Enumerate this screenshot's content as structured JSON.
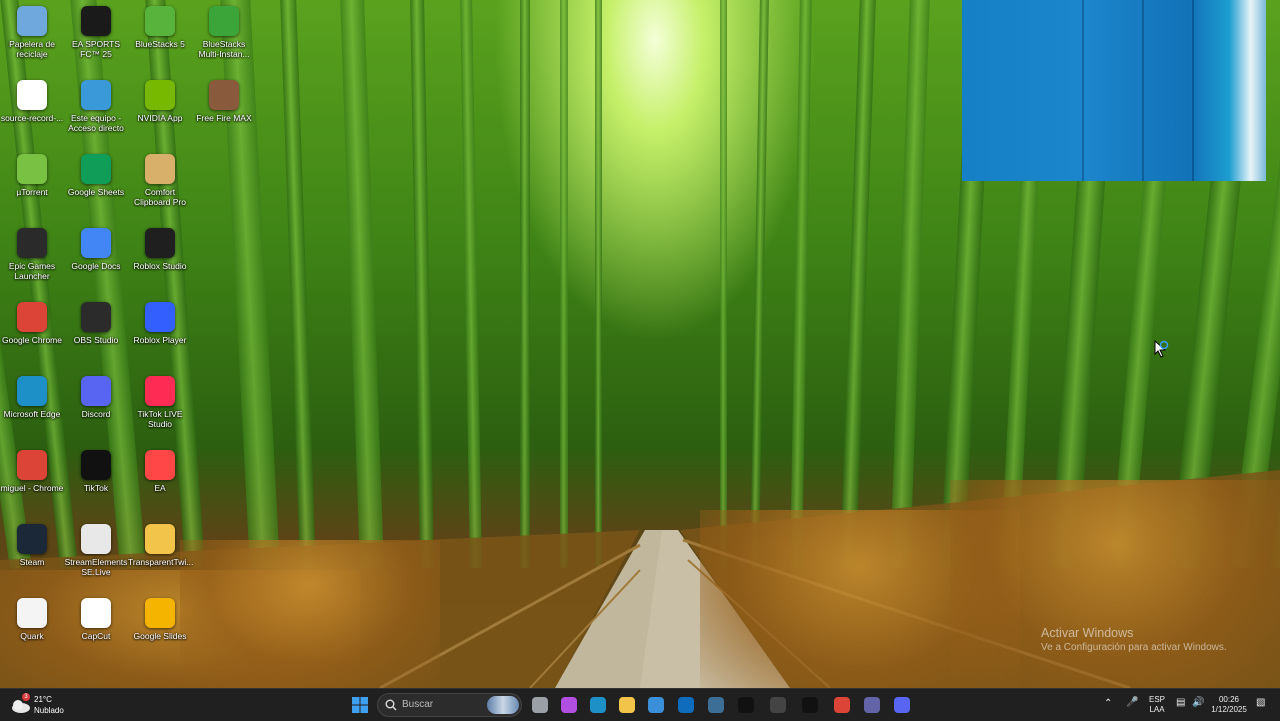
{
  "desktop": {
    "icons": [
      {
        "label": "Papelera de reciclaje",
        "icon": "recycle-bin-icon",
        "color": "#6fa8dc"
      },
      {
        "label": "EA SPORTS FC™ 25",
        "icon": "ea-fc-icon",
        "color": "#1a1a1a"
      },
      {
        "label": "BlueStacks 5",
        "icon": "bluestacks-icon",
        "color": "#58b33c"
      },
      {
        "label": "BlueStacks Multi-Instan...",
        "icon": "bluestacks-multi-icon",
        "color": "#3ba539"
      },
      {
        "label": "source-record-...",
        "icon": "source-record-icon",
        "color": "#ffffff"
      },
      {
        "label": "Este equipo - Acceso directo",
        "icon": "this-pc-icon",
        "color": "#3a9ad9"
      },
      {
        "label": "NVIDIA App",
        "icon": "nvidia-icon",
        "color": "#76b900"
      },
      {
        "label": "Free Fire MAX",
        "icon": "free-fire-icon",
        "color": "#8a5a3c"
      },
      {
        "label": "µTorrent",
        "icon": "utorrent-icon",
        "color": "#79c142"
      },
      {
        "label": "Google Sheets",
        "icon": "google-sheets-icon",
        "color": "#0f9d58"
      },
      {
        "label": "Comfort Clipboard Pro",
        "icon": "clipboard-icon",
        "color": "#d8b06a"
      },
      {
        "label": "Epic Games Launcher",
        "icon": "epic-games-icon",
        "color": "#2a2a2a"
      },
      {
        "label": "Google Docs",
        "icon": "google-docs-icon",
        "color": "#4285f4"
      },
      {
        "label": "Roblox Studio",
        "icon": "roblox-studio-icon",
        "color": "#1f1f1f"
      },
      {
        "label": "Google Chrome",
        "icon": "chrome-icon",
        "color": "#db4437"
      },
      {
        "label": "OBS Studio",
        "icon": "obs-icon",
        "color": "#2b2b2b"
      },
      {
        "label": "Roblox Player",
        "icon": "roblox-player-icon",
        "color": "#335fff"
      },
      {
        "label": "Microsoft Edge",
        "icon": "edge-icon",
        "color": "#1e90c8"
      },
      {
        "label": "Discord",
        "icon": "discord-icon",
        "color": "#5865f2"
      },
      {
        "label": "TikTok LIVE Studio",
        "icon": "tiktok-live-icon",
        "color": "#fe2c55"
      },
      {
        "label": "miguel - Chrome",
        "icon": "chrome-profile-icon",
        "color": "#db4437"
      },
      {
        "label": "TikTok",
        "icon": "tiktok-icon",
        "color": "#111111"
      },
      {
        "label": "EA",
        "icon": "ea-icon",
        "color": "#ff4747"
      },
      {
        "label": "Steam",
        "icon": "steam-icon",
        "color": "#1b2838"
      },
      {
        "label": "StreamElements SE.Live",
        "icon": "streamelements-icon",
        "color": "#e8e8e8"
      },
      {
        "label": "TransparentTwi...",
        "icon": "folder-icon",
        "color": "#f3c44a"
      },
      {
        "label": "Quark",
        "icon": "java-icon",
        "color": "#f4f4f4"
      },
      {
        "label": "CapCut",
        "icon": "capcut-icon",
        "color": "#ffffff"
      },
      {
        "label": "Google Slides",
        "icon": "google-slides-icon",
        "color": "#f4b400"
      }
    ]
  },
  "activation": {
    "title": "Activar Windows",
    "subtitle": "Ve a Configuración para activar Windows."
  },
  "taskbar": {
    "weather": {
      "temp": "21°C",
      "condition": "Nublado",
      "badge": "3"
    },
    "search_placeholder": "Buscar",
    "apps": [
      {
        "name": "task-view-icon",
        "color": "#9aa0a6"
      },
      {
        "name": "copilot-icon",
        "color": "#b04fe0"
      },
      {
        "name": "edge-icon",
        "color": "#1e90c8"
      },
      {
        "name": "file-explorer-icon",
        "color": "#f3c44a"
      },
      {
        "name": "microsoft-store-icon",
        "color": "#3a8fd8"
      },
      {
        "name": "outlook-icon",
        "color": "#0f6cbd"
      },
      {
        "name": "steam-icon",
        "color": "#3d6f96"
      },
      {
        "name": "tiktok-icon",
        "color": "#111111"
      },
      {
        "name": "obs-icon",
        "color": "#444444"
      },
      {
        "name": "tiktok-live-icon",
        "color": "#111111"
      },
      {
        "name": "chrome-icon",
        "color": "#db4437"
      },
      {
        "name": "teams-icon",
        "color": "#6264a7"
      },
      {
        "name": "discord-icon",
        "color": "#5865f2"
      }
    ],
    "language": {
      "line1": "ESP",
      "line2": "LAA"
    },
    "time": "00:26",
    "date": "1/12/2025"
  }
}
